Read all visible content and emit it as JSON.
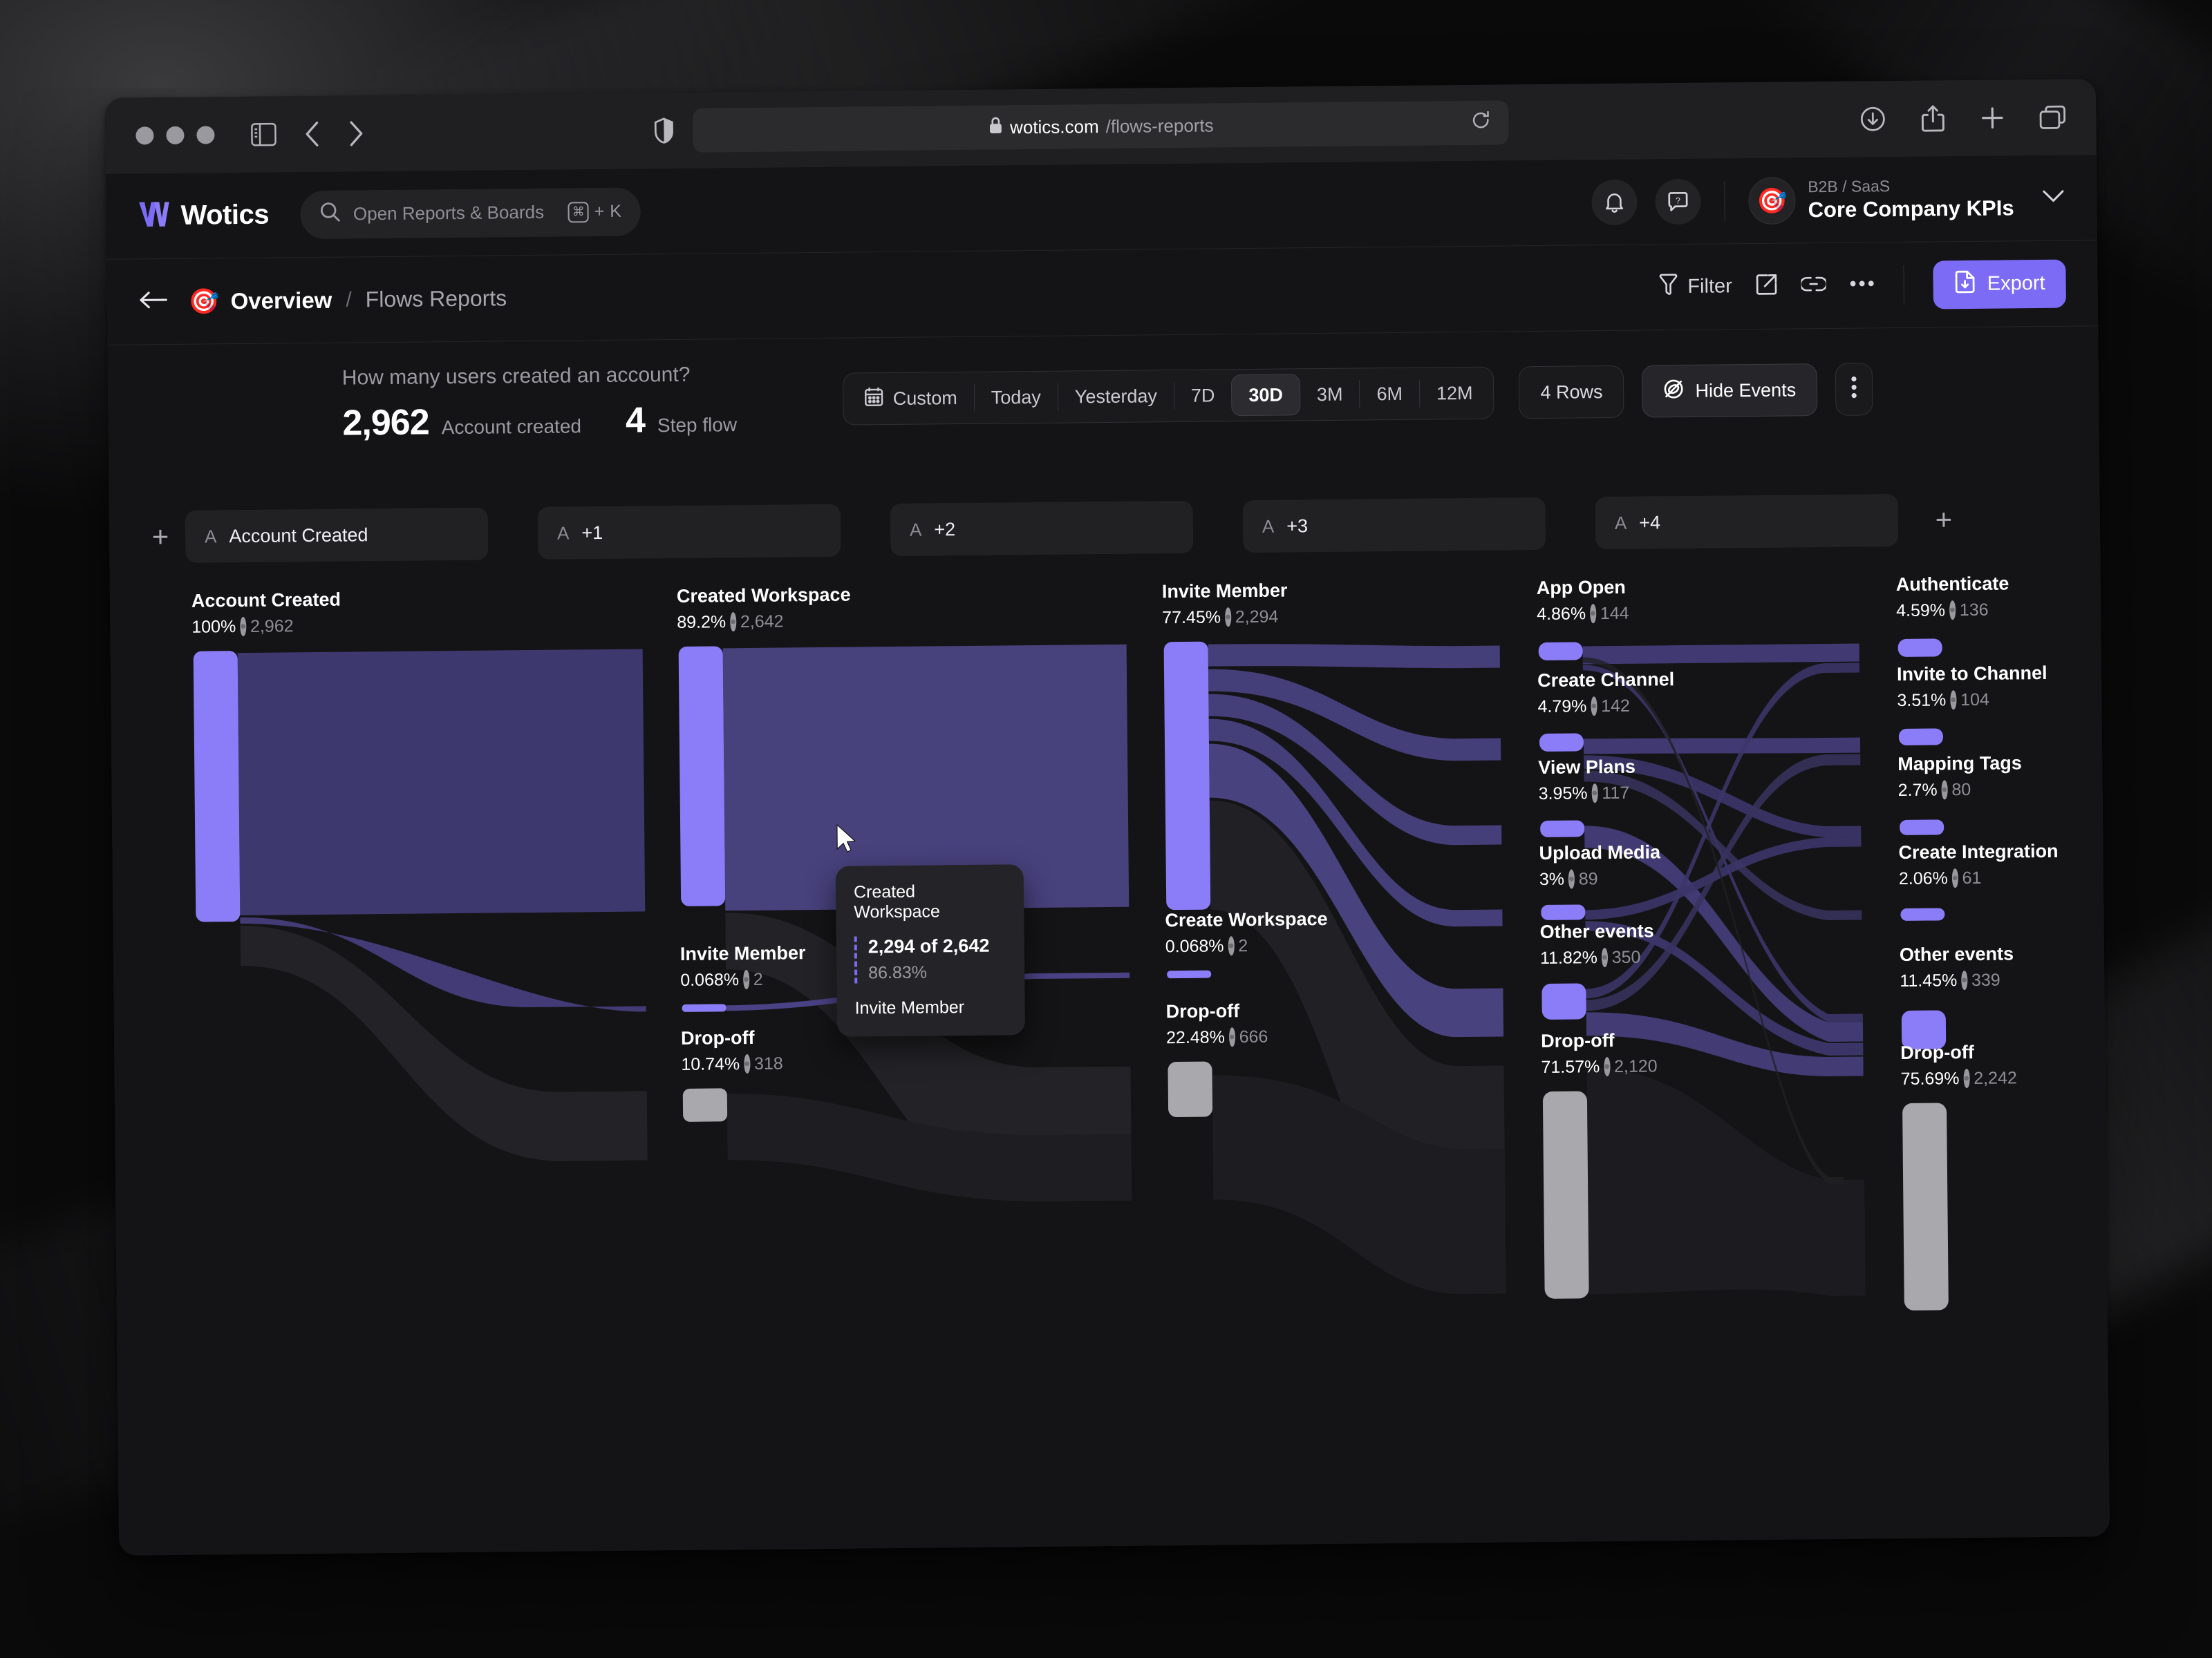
{
  "browser": {
    "url_domain": "wotics.com",
    "url_path": "/flows-reports",
    "lock_icon": "lock-icon",
    "back_icon": "chevron-left-icon",
    "forward_icon": "chevron-right-icon",
    "sidebar_icon": "sidebar-toggle-icon",
    "shield_icon": "shield-icon",
    "reload_icon": "reload-icon",
    "download_icon": "download-icon",
    "share_icon": "share-icon",
    "new_tab_icon": "plus-icon",
    "tabs_icon": "tab-overview-icon"
  },
  "app": {
    "brand": "Wotics",
    "brand_mark": "w-logo-icon",
    "search": {
      "placeholder": "Open Reports & Boards",
      "shortcut_key": "K",
      "shortcut_mod": "⌘",
      "icon": "search-icon"
    },
    "header_actions": {
      "notifications_icon": "bell-icon",
      "help_icon": "help-chat-icon"
    },
    "workspace": {
      "avatar_icon": "dart-target-icon",
      "subtitle": "B2B / SaaS",
      "title": "Core Company KPIs",
      "chevron_icon": "chevron-down-icon"
    },
    "breadcrumb": {
      "back_icon": "arrow-left-icon",
      "icon": "dart-target-icon",
      "root": "Overview",
      "separator": "/",
      "current": "Flows Reports"
    },
    "toolbar": {
      "filter_label": "Filter",
      "filter_icon": "funnel-icon",
      "open_external_icon": "open-external-icon",
      "link_icon": "link-icon",
      "more_icon": "ellipsis-icon",
      "export_label": "Export",
      "export_icon": "file-download-icon",
      "accent_color": "#7c6cf5"
    }
  },
  "summary": {
    "question": "How many users created an account?",
    "metric_value": "2,962",
    "metric_label": "Account created",
    "steps_value": "4",
    "steps_label": "Step flow"
  },
  "range": {
    "custom_label": "Custom",
    "custom_icon": "calendar-icon",
    "options": [
      "Today",
      "Yesterday",
      "7D",
      "30D",
      "3M",
      "6M",
      "12M"
    ],
    "active": "30D",
    "rows_label": "4 Rows",
    "hide_events_label": "Hide Events",
    "hide_events_icon": "eye-off-icon",
    "more_icon": "vertical-ellipsis-icon"
  },
  "steps": {
    "add_left_icon": "plus-icon",
    "add_right_icon": "plus-icon",
    "chips": [
      {
        "prefix": "A",
        "label": "Account Created"
      },
      {
        "prefix": "A",
        "label": "+1"
      },
      {
        "prefix": "A",
        "label": "+2"
      },
      {
        "prefix": "A",
        "label": "+3"
      },
      {
        "prefix": "A",
        "label": "+4"
      }
    ]
  },
  "tooltip": {
    "header": "Created Workspace",
    "value": "2,294 of 2,642",
    "percent": "86.83%",
    "footer": "Invite Member"
  },
  "chart_data": {
    "type": "sankey",
    "title": "How many users created an account?",
    "total": 2962,
    "total_label": "Account created",
    "steps": 4,
    "colors": {
      "node": "#8b7cf8",
      "link": "#453f7a",
      "dropoff_node": "#a9a9ad",
      "dropoff_link": "#232326"
    },
    "columns": [
      {
        "index": 0,
        "nodes": [
          {
            "label": "Account Created",
            "percent": "100%",
            "count": "2,962",
            "value": 2962,
            "kind": "event"
          }
        ]
      },
      {
        "index": 1,
        "nodes": [
          {
            "label": "Created Workspace",
            "percent": "89.2%",
            "count": "2,642",
            "value": 2642,
            "kind": "event"
          },
          {
            "label": "Invite Member",
            "percent": "0.068%",
            "count": "2",
            "value": 2,
            "kind": "event"
          },
          {
            "label": "Drop-off",
            "percent": "10.74%",
            "count": "318",
            "value": 318,
            "kind": "dropoff"
          }
        ]
      },
      {
        "index": 2,
        "nodes": [
          {
            "label": "Invite Member",
            "percent": "77.45%",
            "count": "2,294",
            "value": 2294,
            "kind": "event"
          },
          {
            "label": "Create Workspace",
            "percent": "0.068%",
            "count": "2",
            "value": 2,
            "kind": "event"
          },
          {
            "label": "Drop-off",
            "percent": "22.48%",
            "count": "666",
            "value": 666,
            "kind": "dropoff"
          }
        ]
      },
      {
        "index": 3,
        "nodes": [
          {
            "label": "App Open",
            "percent": "4.86%",
            "count": "144",
            "value": 144,
            "kind": "event"
          },
          {
            "label": "Create Channel",
            "percent": "4.79%",
            "count": "142",
            "value": 142,
            "kind": "event"
          },
          {
            "label": "View Plans",
            "percent": "3.95%",
            "count": "117",
            "value": 117,
            "kind": "event"
          },
          {
            "label": "Upload Media",
            "percent": "3%",
            "count": "89",
            "value": 89,
            "kind": "event"
          },
          {
            "label": "Other events",
            "percent": "11.82%",
            "count": "350",
            "value": 350,
            "kind": "event"
          },
          {
            "label": "Drop-off",
            "percent": "71.57%",
            "count": "2,120",
            "value": 2120,
            "kind": "dropoff"
          }
        ]
      },
      {
        "index": 4,
        "nodes": [
          {
            "label": "Authenticate",
            "percent": "4.59%",
            "count": "136",
            "value": 136,
            "kind": "event"
          },
          {
            "label": "Invite to Channel",
            "percent": "3.51%",
            "count": "104",
            "value": 104,
            "kind": "event"
          },
          {
            "label": "Mapping Tags",
            "percent": "2.7%",
            "count": "80",
            "value": 80,
            "kind": "event"
          },
          {
            "label": "Create Integration",
            "percent": "2.06%",
            "count": "61",
            "value": 61,
            "kind": "event"
          },
          {
            "label": "Other events",
            "percent": "11.45%",
            "count": "339",
            "value": 339,
            "kind": "event"
          },
          {
            "label": "Drop-off",
            "percent": "75.69%",
            "count": "2,242",
            "value": 2242,
            "kind": "dropoff"
          }
        ]
      }
    ],
    "hover": {
      "source": "Created Workspace",
      "target": "Invite Member",
      "value": 2294,
      "of": 2642,
      "percent": "86.83%"
    }
  }
}
